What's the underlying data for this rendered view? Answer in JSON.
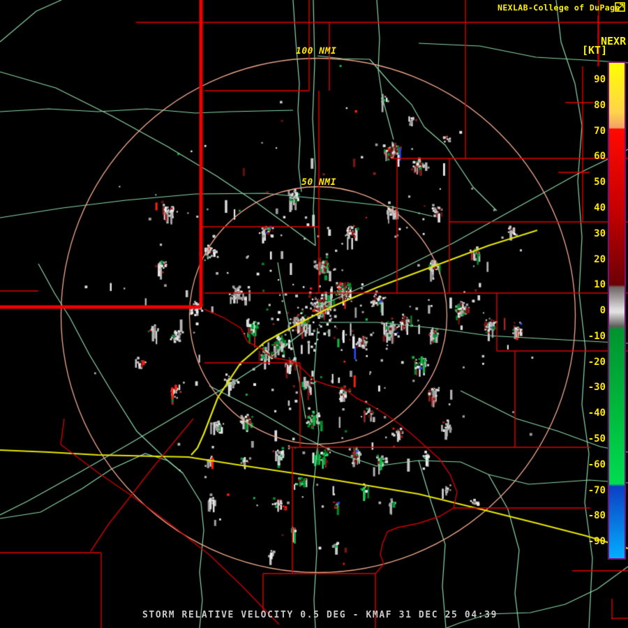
{
  "header": {
    "brand": "NEXLAB-College of DuPage",
    "logo_icon": "cod-weather-logo"
  },
  "colorbar": {
    "product": "NEXR",
    "units": "[KT]",
    "ticks": [
      "90",
      "80",
      "70",
      "60",
      "50",
      "40",
      "30",
      "20",
      "10",
      "0",
      "-10",
      "-20",
      "-30",
      "-40",
      "-50",
      "-60",
      "-70",
      "-80",
      "-90"
    ],
    "scale": {
      "top_value": 96.8,
      "bottom_value": -96.2
    },
    "border_color": "#7A0E7A",
    "stops": [
      {
        "pos": 0.0,
        "color": "#FFFF00"
      },
      {
        "pos": 0.1,
        "color": "#FFD34A"
      },
      {
        "pos": 0.131,
        "color": "#F2A167"
      },
      {
        "pos": 0.134,
        "color": "#FF0A00"
      },
      {
        "pos": 0.3,
        "color": "#C40000"
      },
      {
        "pos": 0.448,
        "color": "#6B0005"
      },
      {
        "pos": 0.453,
        "color": "#6E6464"
      },
      {
        "pos": 0.497,
        "color": "#DCDCDC"
      },
      {
        "pos": 0.503,
        "color": "#E3E3E3"
      },
      {
        "pos": 0.532,
        "color": "#5F5F5A"
      },
      {
        "pos": 0.538,
        "color": "#00932F"
      },
      {
        "pos": 0.7,
        "color": "#00B83C"
      },
      {
        "pos": 0.85,
        "color": "#00DC50"
      },
      {
        "pos": 0.855,
        "color": "#0C3FC4"
      },
      {
        "pos": 0.93,
        "color": "#0878E0"
      },
      {
        "pos": 1.0,
        "color": "#00AEFF"
      }
    ]
  },
  "rings": [
    {
      "label": "100 NMI",
      "radius_nmi": 100
    },
    {
      "label": "50 NMI",
      "radius_nmi": 50
    }
  ],
  "footer": {
    "title": "STORM RELATIVE VELOCITY 0.5 DEG - KMAF 31 DEC 25 04:39"
  },
  "map": {
    "colors": {
      "background": "#000000",
      "county_line": "#E00000",
      "state_line": "#F00000",
      "river_line": "#D00000",
      "road": "#8CD8A8",
      "highway": "#E8E800",
      "range_ring": "#F2A98C"
    },
    "speckle_palette": {
      "gray": [
        "#9C9C9C",
        "#B4B4B4",
        "#C8C8C8",
        "#DCDCDC",
        "#EDEDED"
      ],
      "dark_red": [
        "#781414",
        "#8C1E1E",
        "#A02828",
        "#641010"
      ],
      "green": [
        "#008A2C",
        "#00A038",
        "#14B446",
        "#007824"
      ],
      "bright_red": "#FF1E0A",
      "blue": "#2846FF",
      "bright_green": "#28E664"
    }
  }
}
